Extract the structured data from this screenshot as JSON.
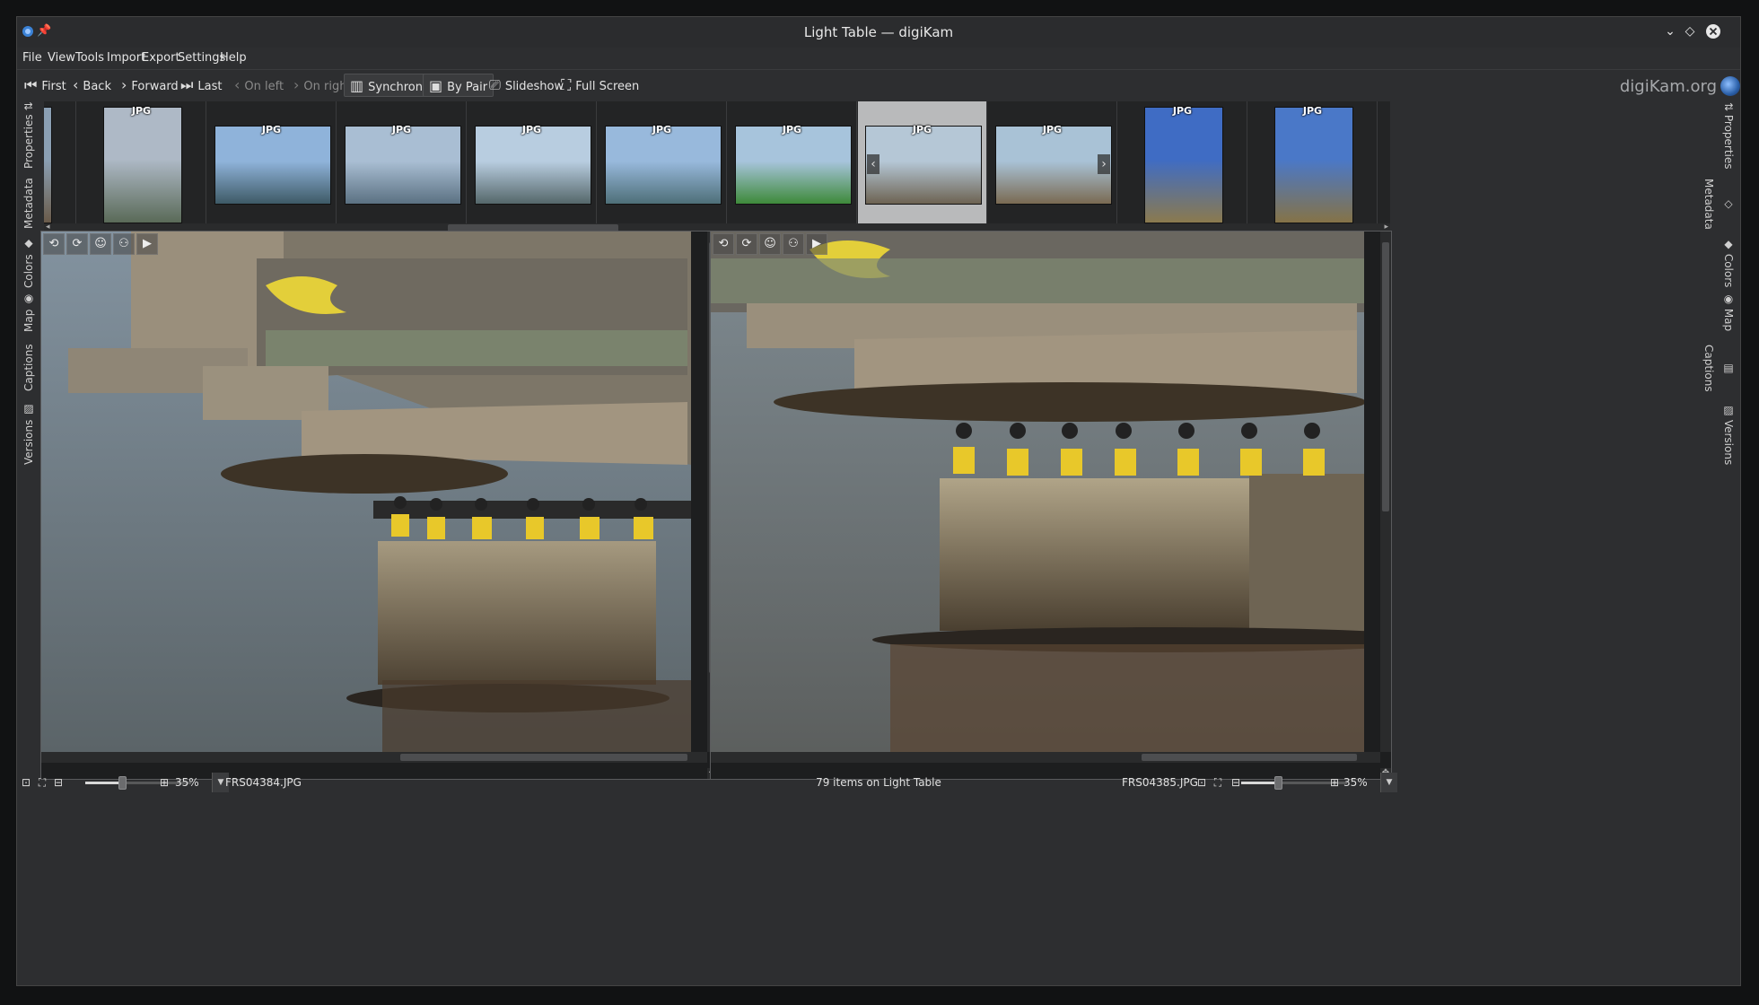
{
  "window": {
    "title": "Light Table — digiKam",
    "controls": [
      "minimize",
      "maximize",
      "close"
    ]
  },
  "menubar": [
    "File",
    "View",
    "Tools",
    "Import",
    "Export",
    "Settings",
    "Help"
  ],
  "toolbar": {
    "first": "First",
    "back": "Back",
    "forward": "Forward",
    "last": "Last",
    "on_left": "On left",
    "on_right": "On right",
    "synchronize": "Synchronize",
    "by_pair": "By Pair",
    "slideshow": "Slideshow",
    "full_screen": "Full Screen",
    "brand": "digiKam.org"
  },
  "left_sidebar_tabs": [
    "Properties",
    "Metadata",
    "Colors",
    "Map",
    "Captions",
    "Versions"
  ],
  "right_sidebar_tabs": [
    "Properties",
    "Metadata",
    "Colors",
    "Map",
    "Captions",
    "Versions"
  ],
  "thumbnails": [
    {
      "format": "",
      "orientation": "portrait",
      "colors": [
        "#8ba0b4",
        "#6a5b4a"
      ]
    },
    {
      "format": "JPG",
      "orientation": "portrait",
      "colors": [
        "#aeb9c6",
        "#5a6a58"
      ]
    },
    {
      "format": "JPG",
      "orientation": "landscape",
      "colors": [
        "#8fb3da",
        "#3e5a66"
      ]
    },
    {
      "format": "JPG",
      "orientation": "landscape",
      "colors": [
        "#a9bed3",
        "#5b7182"
      ]
    },
    {
      "format": "JPG",
      "orientation": "landscape",
      "colors": [
        "#b8cde0",
        "#55676a"
      ]
    },
    {
      "format": "JPG",
      "orientation": "landscape",
      "colors": [
        "#98b9dc",
        "#4e6f78"
      ]
    },
    {
      "format": "JPG",
      "orientation": "landscape",
      "colors": [
        "#a7c4dc",
        "#3e8a3a"
      ]
    },
    {
      "format": "JPG",
      "orientation": "landscape",
      "colors": [
        "#b5c7d6",
        "#6d6352"
      ],
      "selected": true
    },
    {
      "format": "JPG",
      "orientation": "landscape",
      "colors": [
        "#a9c2d6",
        "#7a6a52"
      ]
    },
    {
      "format": "JPG",
      "orientation": "portrait",
      "colors": [
        "#3f6cc4",
        "#8b7a4e"
      ]
    },
    {
      "format": "JPG",
      "orientation": "portrait",
      "colors": [
        "#4a78c8",
        "#857347"
      ]
    }
  ],
  "preview_tools": [
    "rotate-left",
    "rotate-right",
    "face-tag",
    "person-add",
    "play"
  ],
  "statusbar": {
    "left_zoom": "35%",
    "left_filename": "FRS04384.JPG",
    "center": "79 items on Light Table",
    "right_filename": "FRS04385.JPG",
    "right_zoom": "35%",
    "left_zoom_level": 0.35,
    "right_zoom_level": 0.35
  },
  "colors": {
    "window_bg": "#2d2e30",
    "thumbbar_bg": "#232425",
    "selected_thumb": "#b9babb",
    "text": "#e1e1e1",
    "disabled_text": "#8a8a8a"
  }
}
